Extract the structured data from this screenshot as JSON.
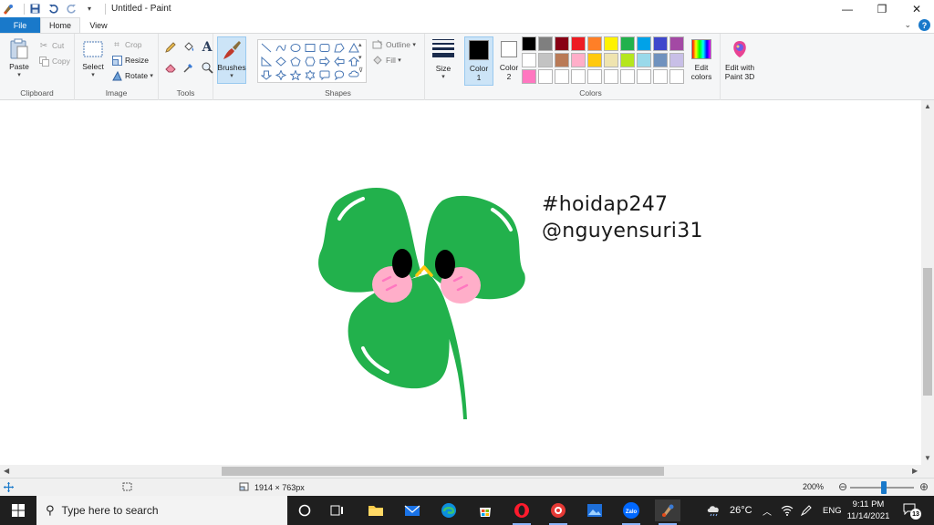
{
  "window": {
    "title": "Untitled - Paint",
    "controls": {
      "minimize": "—",
      "maximize": "❐",
      "close": "✕"
    }
  },
  "tabs": {
    "file": "File",
    "home": "Home",
    "view": "View"
  },
  "ribbon": {
    "clipboard": {
      "label": "Clipboard",
      "paste": "Paste",
      "cut": "Cut",
      "copy": "Copy"
    },
    "image": {
      "label": "Image",
      "select": "Select",
      "crop": "Crop",
      "resize": "Resize",
      "rotate": "Rotate"
    },
    "tools": {
      "label": "Tools"
    },
    "brushes": {
      "label": "Brushes"
    },
    "shapes": {
      "label": "Shapes",
      "outline": "Outline",
      "fill": "Fill"
    },
    "size": {
      "label": "Size"
    },
    "colors": {
      "label": "Colors",
      "color1": "Color\n1",
      "color1_a": "Color",
      "color1_b": "1",
      "color2_a": "Color",
      "color2_b": "2",
      "color1_value": "#000000",
      "color2_value": "#ffffff",
      "edit_colors_a": "Edit",
      "edit_colors_b": "colors",
      "palette": [
        "#000000",
        "#7f7f7f",
        "#880015",
        "#ed1c24",
        "#ff7f27",
        "#fff200",
        "#22b14c",
        "#00a2e8",
        "#3f48cc",
        "#a349a4",
        "#ffffff",
        "#c3c3c3",
        "#b97a57",
        "#ffaec9",
        "#ffc90e",
        "#efe4b0",
        "#b5e61d",
        "#99d9ea",
        "#7092be",
        "#c8bfe7",
        "#ff77c0",
        "#ffffff",
        "#ffffff",
        "#ffffff",
        "#ffffff",
        "#ffffff",
        "#ffffff",
        "#ffffff",
        "#ffffff",
        "#ffffff"
      ]
    },
    "paint3d": {
      "line1": "Edit with",
      "line2": "Paint 3D"
    }
  },
  "canvas": {
    "text_line1": "#hoidap247",
    "text_line2": "@nguyensuri31",
    "clover_color": "#22b14c",
    "blush_color": "#ffaec9",
    "nose_color": "#ffc90e"
  },
  "statusbar": {
    "dimensions": "1914 × 763px",
    "zoom": "200%",
    "zoom_percent": 200
  },
  "taskbar": {
    "search_placeholder": "Type here to search",
    "weather": "26°C",
    "language": "ENG",
    "time": "9:11 PM",
    "date": "11/14/2021",
    "notifications": "13",
    "apps": [
      "task-view",
      "file-explorer",
      "mail",
      "edge",
      "store",
      "opera",
      "app-red",
      "photos",
      "zalo",
      "paint"
    ]
  }
}
